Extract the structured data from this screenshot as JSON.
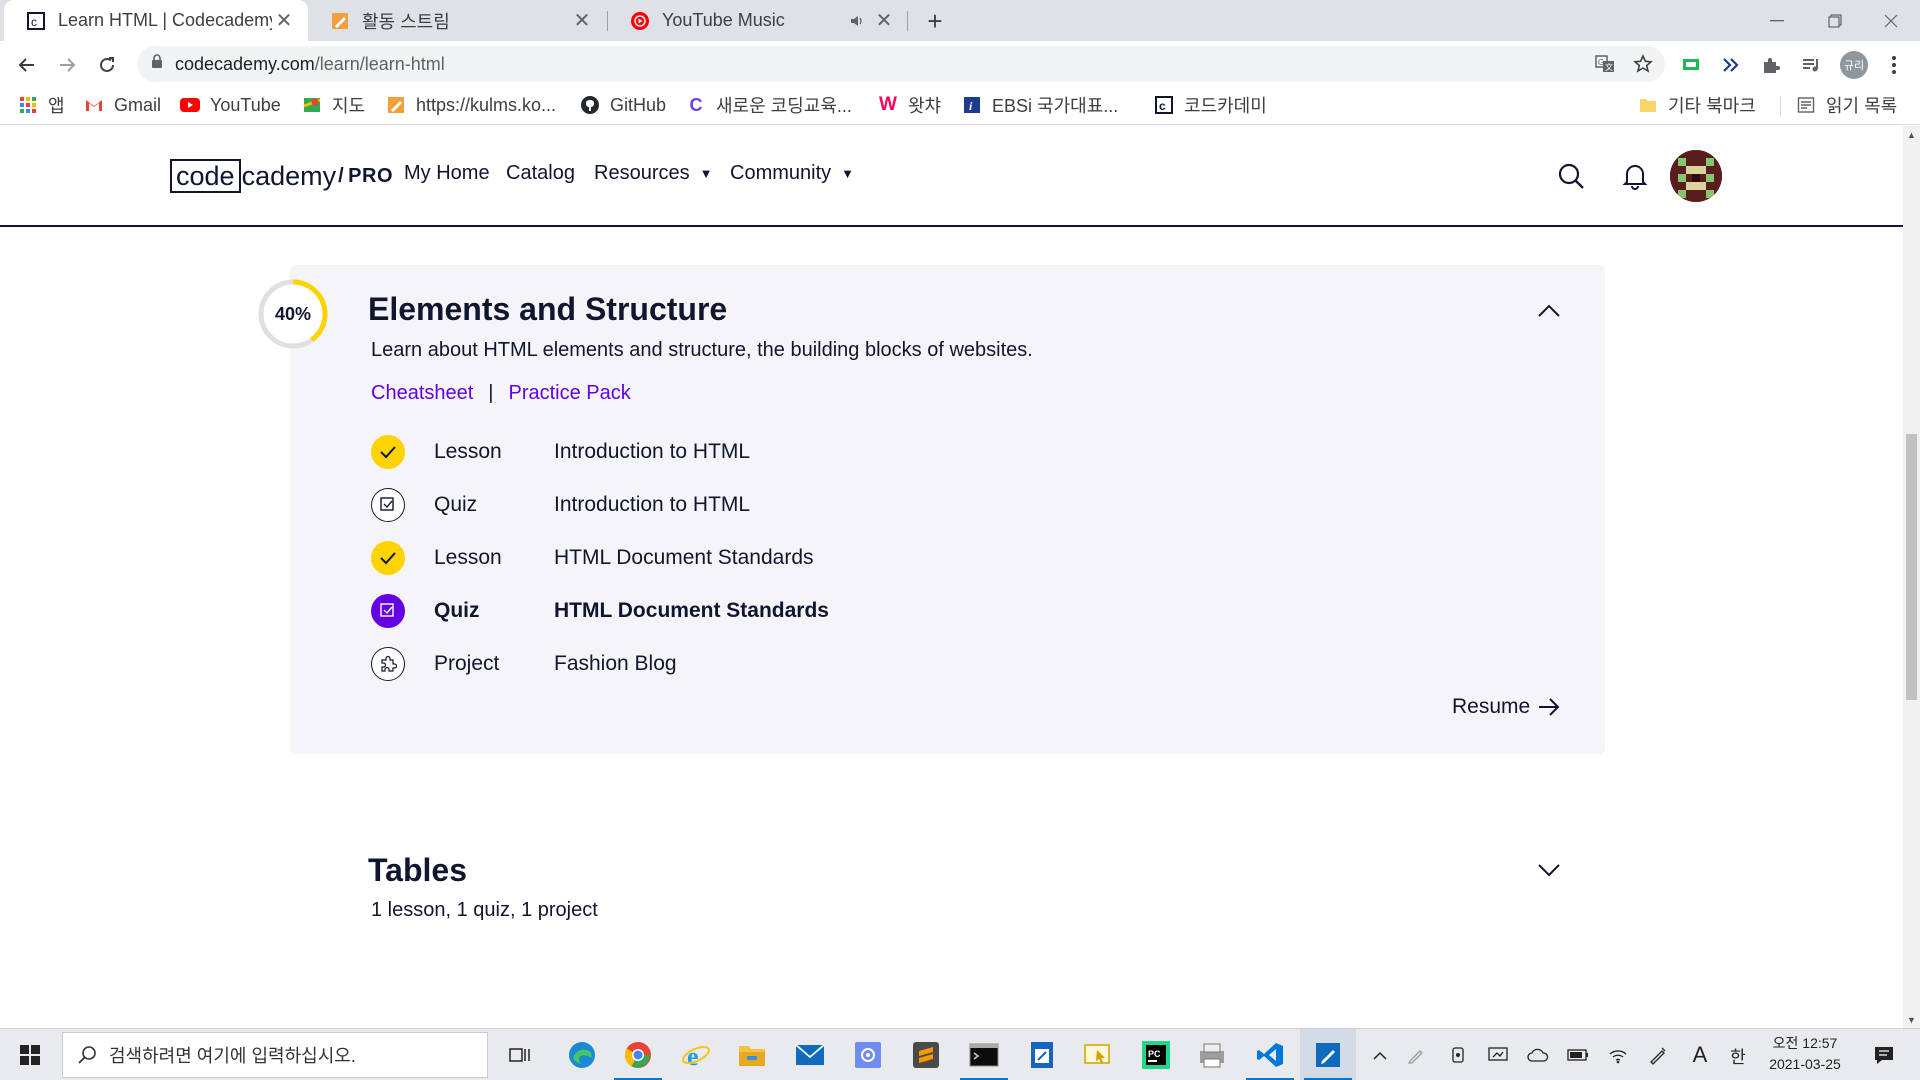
{
  "browser": {
    "tabs": [
      {
        "label": "Learn HTML | Codecademy",
        "favicon": "codecademy-icon",
        "active": true
      },
      {
        "label": "활동 스트림",
        "favicon": "pencil-note-icon",
        "active": false
      },
      {
        "label": "YouTube Music",
        "favicon": "youtube-music-icon",
        "active": false
      }
    ],
    "new_tab_label": "+",
    "url_host": "codecademy.com",
    "url_path": "/learn/learn-html",
    "profile_label": "규리",
    "bookmarks": [
      {
        "label": "앱",
        "icon": "apps-grid-icon"
      },
      {
        "label": "Gmail",
        "icon": "gmail-icon"
      },
      {
        "label": "YouTube",
        "icon": "youtube-icon"
      },
      {
        "label": "지도",
        "icon": "maps-icon"
      },
      {
        "label": "https://kulms.ko...",
        "icon": "pencil-note-icon"
      },
      {
        "label": "GitHub",
        "icon": "github-icon"
      },
      {
        "label": "새로운 코딩교육...",
        "icon": "c-logo-icon"
      },
      {
        "label": "왓챠",
        "icon": "watcha-icon"
      },
      {
        "label": "EBSi 국가대표...",
        "icon": "ebsi-icon"
      },
      {
        "label": "코드카데미",
        "icon": "codecademy-icon"
      }
    ],
    "other_bookmarks": "기타 북마크",
    "reading_list": "읽기 목록"
  },
  "site": {
    "logo": {
      "left": "code",
      "right": "cademy",
      "slash": "/",
      "pro": "PRO"
    },
    "nav": {
      "my_home": "My Home",
      "catalog": "Catalog",
      "resources": "Resources",
      "community": "Community",
      "caret": "▼"
    }
  },
  "module": {
    "progress_text": "40%",
    "progress_value": 0.4,
    "title": "Elements and Structure",
    "description": "Learn about HTML elements and structure, the building blocks of websites.",
    "links": {
      "cheatsheet": "Cheatsheet",
      "separator": "|",
      "practice": "Practice Pack"
    },
    "items": [
      {
        "type": "Lesson",
        "name": "Introduction to HTML",
        "status": "done"
      },
      {
        "type": "Quiz",
        "name": "Introduction to HTML",
        "status": "todo"
      },
      {
        "type": "Lesson",
        "name": "HTML Document Standards",
        "status": "done"
      },
      {
        "type": "Quiz",
        "name": "HTML Document Standards",
        "status": "current"
      },
      {
        "type": "Project",
        "name": "Fashion Blog",
        "status": "todo"
      }
    ],
    "resume": "Resume"
  },
  "next_module": {
    "title": "Tables",
    "summary": "1 lesson, 1 quiz, 1 project"
  },
  "taskbar": {
    "search_placeholder": "검색하려면 여기에 입력하십시오.",
    "ime_a": "A",
    "ime_lang": "한",
    "time": "오전 12:57",
    "date": "2021-03-25"
  },
  "colors": {
    "brand_navy": "#10162f",
    "accent_purple": "#6400e4",
    "accent_yellow": "#ffd300",
    "card_bg": "#f5f5f9"
  }
}
